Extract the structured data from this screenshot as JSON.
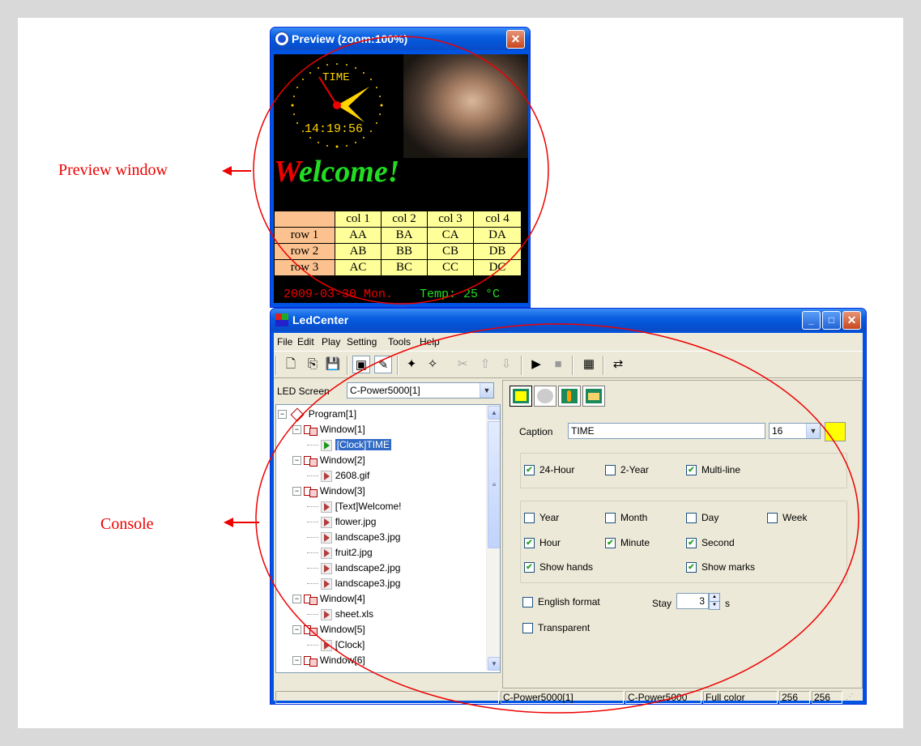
{
  "annotations": {
    "preview_label": "Preview window",
    "console_label": "Console",
    "color": "#ee0000"
  },
  "preview": {
    "title": "Preview (zoom:100%)",
    "clock_caption": "TIME",
    "clock_time": "14:19:56",
    "welcome_first": "W",
    "welcome_rest": "elcome!",
    "table": {
      "headers": [
        "",
        "col 1",
        "col 2",
        "col 3",
        "col 4"
      ],
      "rows": [
        {
          "label": "row 1",
          "cells": [
            "AA",
            "BA",
            "CA",
            "DA"
          ]
        },
        {
          "label": "row 2",
          "cells": [
            "AB",
            "BB",
            "CB",
            "DB"
          ]
        },
        {
          "label": "row 3",
          "cells": [
            "AC",
            "BC",
            "CC",
            "DC"
          ]
        }
      ]
    },
    "date_text": "2009-03-30 Mon.",
    "temp_text": "Temp: 25 °C"
  },
  "ledcenter": {
    "title": "LedCenter",
    "menu": [
      "File",
      "Edit",
      "Play",
      "Setting",
      "Tools",
      "Help"
    ],
    "led_screen_label": "LED Screen",
    "led_screen_value": "C-Power5000[1]",
    "tree": [
      {
        "text": "Program[1]",
        "level": 0,
        "type": "program"
      },
      {
        "text": "Window[1]",
        "level": 1,
        "type": "window"
      },
      {
        "text": "[Clock]TIME",
        "level": 2,
        "type": "item-selected"
      },
      {
        "text": "Window[2]",
        "level": 1,
        "type": "window"
      },
      {
        "text": "2608.gif",
        "level": 2,
        "type": "item"
      },
      {
        "text": "Window[3]",
        "level": 1,
        "type": "window"
      },
      {
        "text": "[Text]Welcome!",
        "level": 2,
        "type": "item"
      },
      {
        "text": "flower.jpg",
        "level": 2,
        "type": "item"
      },
      {
        "text": "landscape3.jpg",
        "level": 2,
        "type": "item"
      },
      {
        "text": "fruit2.jpg",
        "level": 2,
        "type": "item"
      },
      {
        "text": "landscape2.jpg",
        "level": 2,
        "type": "item"
      },
      {
        "text": "landscape3.jpg",
        "level": 2,
        "type": "item"
      },
      {
        "text": "Window[4]",
        "level": 1,
        "type": "window"
      },
      {
        "text": "sheet.xls",
        "level": 2,
        "type": "item"
      },
      {
        "text": "Window[5]",
        "level": 1,
        "type": "window"
      },
      {
        "text": "[Clock]",
        "level": 2,
        "type": "item"
      },
      {
        "text": "Window[6]",
        "level": 1,
        "type": "window"
      }
    ],
    "caption_label": "Caption",
    "caption_value": "TIME",
    "font_size": "16",
    "caption_color": "#ffff00",
    "options_group1": [
      {
        "label": "24-Hour",
        "checked": true
      },
      {
        "label": "2-Year",
        "checked": false
      },
      {
        "label": "Multi-line",
        "checked": true
      }
    ],
    "options_group2": [
      {
        "label": "Year",
        "checked": false
      },
      {
        "label": "Month",
        "checked": false
      },
      {
        "label": "Day",
        "checked": false
      },
      {
        "label": "Week",
        "checked": false
      },
      {
        "label": "Hour",
        "checked": true
      },
      {
        "label": "Minute",
        "checked": true
      },
      {
        "label": "Second",
        "checked": true
      },
      {
        "label": "Show hands",
        "checked": true
      },
      {
        "label": "Show marks",
        "checked": true
      }
    ],
    "english_format": {
      "label": "English format",
      "checked": false
    },
    "transparent": {
      "label": "Transparent",
      "checked": false
    },
    "stay_label": "Stay",
    "stay_value": "3",
    "stay_unit": "s",
    "status": [
      "C-Power5000[1]",
      "C-Power5000",
      "Full color",
      "256",
      "256"
    ]
  }
}
